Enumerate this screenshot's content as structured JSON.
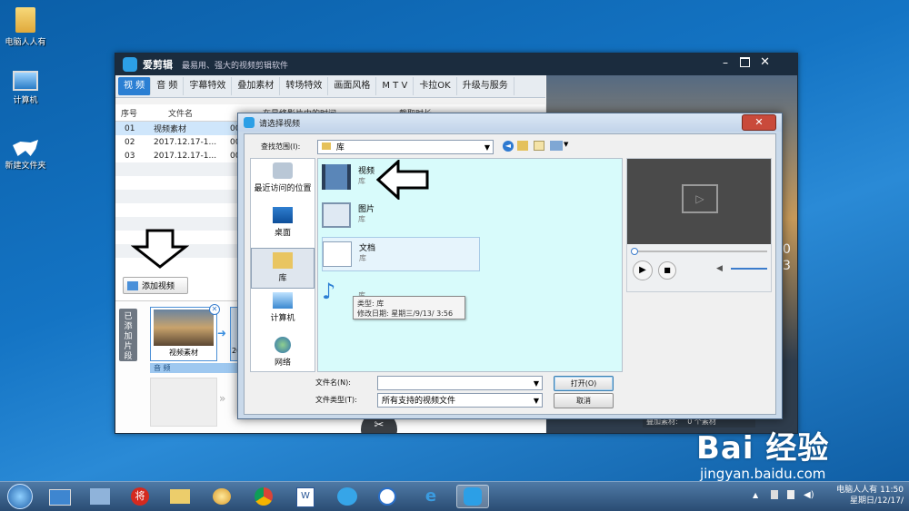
{
  "desktop": {
    "icons": [
      {
        "label": "电脑人人有"
      },
      {
        "label": "计算机"
      },
      {
        "label": "新建文件夹"
      }
    ]
  },
  "app": {
    "title": "爱剪辑",
    "subtitle": "最易用、强大的视频剪辑软件",
    "tabs": [
      "视 频",
      "音 频",
      "字幕特效",
      "叠加素材",
      "转场特效",
      "画面风格",
      "M T V",
      "卡拉OK",
      "升级与服务"
    ],
    "table": {
      "headers": [
        "序号",
        "文件名",
        "在最终影片中的时间",
        "截取时长"
      ],
      "rows": [
        {
          "no": "01",
          "name": "视频素材",
          "time": "00:0"
        },
        {
          "no": "02",
          "name": "2017.12.17-1...",
          "time": "00:0"
        },
        {
          "no": "03",
          "name": "2017.12.17-1...",
          "time": "00:0"
        }
      ]
    },
    "add_video_label": "添加视频",
    "added_clips_label": "已添加片段",
    "clip_label": "视频素材",
    "audio_label": "音 频",
    "clip2_prefix": "20",
    "overlay_label": "叠加素材:",
    "overlay_count": "0 个素材",
    "side_chars": [
      "0",
      "3"
    ]
  },
  "dialog": {
    "title": "请选择视频",
    "lookin_label": "查找范围(I):",
    "lookin_value": "库",
    "places": [
      "最近访问的位置",
      "桌面",
      "库",
      "计算机",
      "网络"
    ],
    "items": [
      {
        "name": "视频",
        "sub": "库"
      },
      {
        "name": "图片",
        "sub": "库"
      },
      {
        "name": "文档",
        "sub": "库"
      },
      {
        "name": "音乐",
        "sub": "库"
      }
    ],
    "tooltip_type": "类型: 库",
    "tooltip_date": "修改日期: 星期三/9/13/ 3:56",
    "filename_label": "文件名(N):",
    "filename_value": "",
    "filetype_label": "文件类型(T):",
    "filetype_value": "所有支持的视频文件",
    "open_button": "打开(O)",
    "cancel_button": "取消"
  },
  "taskbar": {
    "user": "电脑人人有",
    "time": "11:50",
    "date": "星期日/12/17/"
  },
  "watermark": {
    "brand": "Bai 经验",
    "url": "jingyan.baidu.com"
  },
  "colors": {
    "accent": "#2b7fd3",
    "dialog_list_bg": "#d8fbfb",
    "titlebar": "#1b2c3e"
  }
}
